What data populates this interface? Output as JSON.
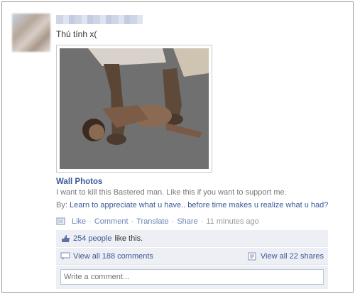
{
  "post": {
    "status_text": "Thú tính x(",
    "album_title": "Wall Photos",
    "caption": "I want to kill this Bastered man. Like this if you want to support me.",
    "byline_prefix": "By: ",
    "byline_link": "Learn to appreciate what u have.. before time makes u realize what u had?"
  },
  "actions": {
    "like": "Like",
    "comment": "Comment",
    "translate": "Translate",
    "share": "Share",
    "separator": "·",
    "timestamp": "11 minutes ago"
  },
  "ufi": {
    "likes_count_text": "254 people",
    "likes_suffix": "like this.",
    "view_comments": "View all 188 comments",
    "view_shares": "View all 22 shares",
    "comment_placeholder": "Write a comment..."
  },
  "colors": {
    "link": "#3b5998",
    "ufi_bg": "#edeff4"
  }
}
